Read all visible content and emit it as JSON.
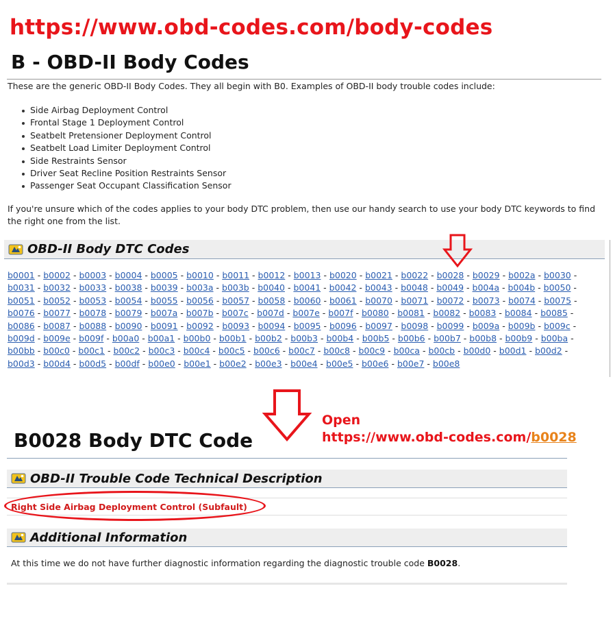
{
  "header": {
    "url": "https://www.obd-codes.com/body-codes",
    "title": "B - OBD-II Body Codes"
  },
  "intro": "These are the generic OBD-II Body Codes. They all begin with B0. Examples of OBD-II body trouble codes include:",
  "examples": [
    "Side Airbag Deployment Control",
    "Frontal Stage 1 Deployment Control",
    "Seatbelt Pretensioner Deployment Control",
    "Seatbelt Load Limiter Deployment Control",
    "Side Restraints Sensor",
    "Driver Seat Recline Position Restraints Sensor",
    "Passenger Seat Occupant Classification Sensor"
  ],
  "unsure_text": "If you're unsure which of the codes applies to your body DTC problem, then use our handy search to use your body DTC keywords to find the right one from the list.",
  "dtc_section": {
    "title": "OBD-II Body DTC Codes",
    "icon": "warning-light-icon",
    "rows": [
      [
        "b0001",
        "b0002",
        "b0003",
        "b0004",
        "b0005",
        "b0010",
        "b0011",
        "b0012",
        "b0013",
        "b0020",
        "b0021",
        "b0022",
        "b0028",
        "b0029",
        "b002a",
        "b0030"
      ],
      [
        "b0031",
        "b0032",
        "b0033",
        "b0038",
        "b0039",
        "b003a",
        "b003b",
        "b0040",
        "b0041",
        "b0042",
        "b0043",
        "b0048",
        "b0049",
        "b004a",
        "b004b",
        "b0050"
      ],
      [
        "b0051",
        "b0052",
        "b0053",
        "b0054",
        "b0055",
        "b0056",
        "b0057",
        "b0058",
        "b0060",
        "b0061",
        "b0070",
        "b0071",
        "b0072",
        "b0073",
        "b0074",
        "b0075"
      ],
      [
        "b0076",
        "b0077",
        "b0078",
        "b0079",
        "b007a",
        "b007b",
        "b007c",
        "b007d",
        "b007e",
        "b007f",
        "b0080",
        "b0081",
        "b0082",
        "b0083",
        "b0084",
        "b0085"
      ],
      [
        "b0086",
        "b0087",
        "b0088",
        "b0090",
        "b0091",
        "b0092",
        "b0093",
        "b0094",
        "b0095",
        "b0096",
        "b0097",
        "b0098",
        "b0099",
        "b009a",
        "b009b",
        "b009c"
      ],
      [
        "b009d",
        "b009e",
        "b009f",
        "b00a0",
        "b00a1",
        "b00b0",
        "b00b1",
        "b00b2",
        "b00b3",
        "b00b4",
        "b00b5",
        "b00b6",
        "b00b7",
        "b00b8",
        "b00b9",
        "b00ba"
      ],
      [
        "b00bb",
        "b00c0",
        "b00c1",
        "b00c2",
        "b00c3",
        "b00c4",
        "b00c5",
        "b00c6",
        "b00c7",
        "b00c8",
        "b00c9",
        "b00ca",
        "b00cb",
        "b00d0",
        "b00d1",
        "b00d2"
      ],
      [
        "b00d3",
        "b00d4",
        "b00d5",
        "b00df",
        "b00e0",
        "b00e1",
        "b00e2",
        "b00e3",
        "b00e4",
        "b00e5",
        "b00e6",
        "b00e7",
        "b00e8"
      ]
    ],
    "separator": " - "
  },
  "annotation": {
    "open_label": "Open",
    "open_url_prefix": "https://www.obd-codes.com/",
    "open_url_code": "b0028",
    "arrow_color": "#e8151b"
  },
  "code_page": {
    "title": "B0028 Body DTC Code",
    "tech_section_title": "OBD-II Trouble Code Technical Description",
    "tech_description": "Right Side Airbag Deployment Control (Subfault)",
    "additional_section_title": "Additional Information",
    "additional_text_prefix": "At this time we do not have further diagnostic information regarding the diagnostic trouble code ",
    "additional_text_code": "B0028",
    "additional_text_suffix": "."
  },
  "colors": {
    "annotation_red": "#e8151b",
    "link_blue": "#2a5db0",
    "link_orange": "#e8831b",
    "description_red": "#d11a1a",
    "section_bg": "#eeeeee"
  }
}
